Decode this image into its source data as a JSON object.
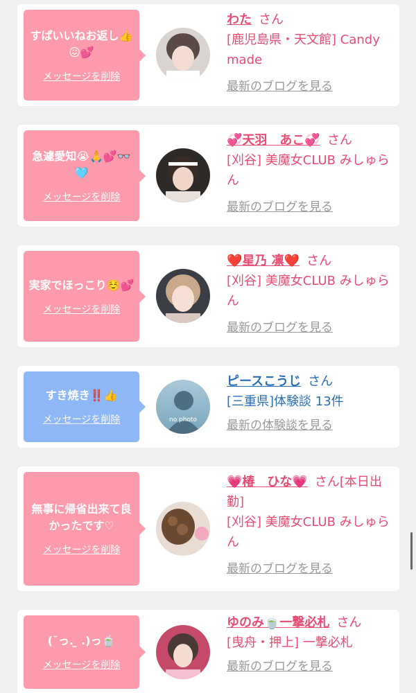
{
  "delete_label": "メッセージを削除",
  "san": "さん",
  "cards": [
    {
      "message": "すぱいいねお返し👍😖💕",
      "name": "わた",
      "shop": "[鹿児島県・天文館] Candy made",
      "link": "最新のブログを見る"
    },
    {
      "message": "急遽愛知😭🙏💕👓🩵",
      "name": "💞天羽　あこ💞",
      "shop": "[刈谷] 美魔女CLUB みしゅらん",
      "link": "最新のブログを見る"
    },
    {
      "message": "実家でほっこり☺️💕",
      "name": "❤️星乃 凛❤️",
      "shop": "[刈谷] 美魔女CLUB みしゅらん",
      "link": "最新のブログを見る"
    },
    {
      "message": "すき焼き‼️👍",
      "name": "ピースこうじ",
      "shop": "[三重県]体験談 13件",
      "link": "最新の体験談を見る",
      "avatar_text": "no photo"
    },
    {
      "message": "無事に帰省出来て良かったです♡",
      "name": "💗椿　ひな💗",
      "san_suffix": "[本日出勤]",
      "shop": "[刈谷] 美魔女CLUB みしゅらん",
      "link": "最新のブログを見る"
    },
    {
      "message": "(˘っ. ̫ .)っ🍵",
      "name": "ゆのみ🍵一撃必札",
      "shop": "[曳舟・押上] 一撃必札",
      "link": "最新のブログを見る"
    }
  ]
}
